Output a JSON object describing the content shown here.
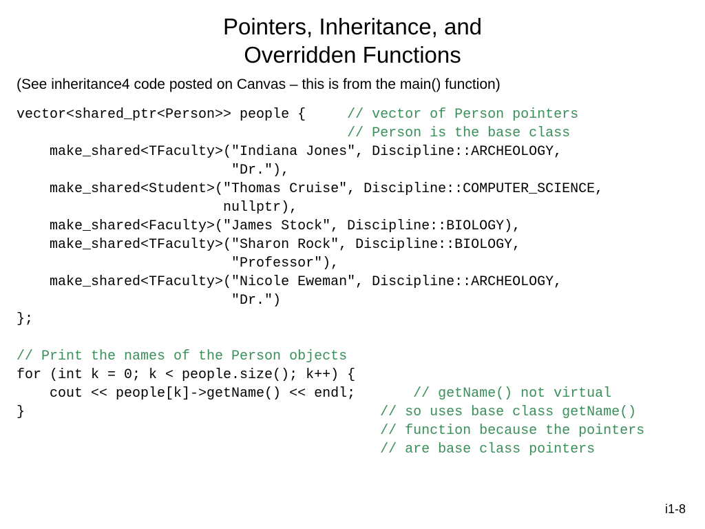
{
  "title_line1": "Pointers, Inheritance, and",
  "title_line2": "Overridden Functions",
  "note": "(See inheritance4 code posted on Canvas – this is from the main() function)",
  "code": {
    "l1a": "vector<shared_ptr<Person>> people {     ",
    "l1c": "// vector of Person pointers",
    "l2a": "                                        ",
    "l2c": "// Person is the base class",
    "l3": "    make_shared<TFaculty>(\"Indiana Jones\", Discipline::ARCHEOLOGY,",
    "l4": "                          \"Dr.\"),",
    "l5": "    make_shared<Student>(\"Thomas Cruise\", Discipline::COMPUTER_SCIENCE,",
    "l6": "                         nullptr),",
    "l7": "    make_shared<Faculty>(\"James Stock\", Discipline::BIOLOGY),",
    "l8": "    make_shared<TFaculty>(\"Sharon Rock\", Discipline::BIOLOGY,",
    "l9": "                          \"Professor\"),",
    "l10": "    make_shared<TFaculty>(\"Nicole Eweman\", Discipline::ARCHEOLOGY,",
    "l11": "                          \"Dr.\")",
    "l12": "};",
    "blank": "",
    "l13c": "// Print the names of the Person objects",
    "l14": "for (int k = 0; k < people.size(); k++) {",
    "l15a": "    cout << people[k]->getName() << endl;       ",
    "l15c": "// getName() not virtual",
    "l16a": "}                                           ",
    "l16c": "// so uses base class getName()",
    "l17a": "                                            ",
    "l17c": "// function because the pointers",
    "l18a": "                                            ",
    "l18c": "// are base class pointers"
  },
  "footer": "i1-8"
}
